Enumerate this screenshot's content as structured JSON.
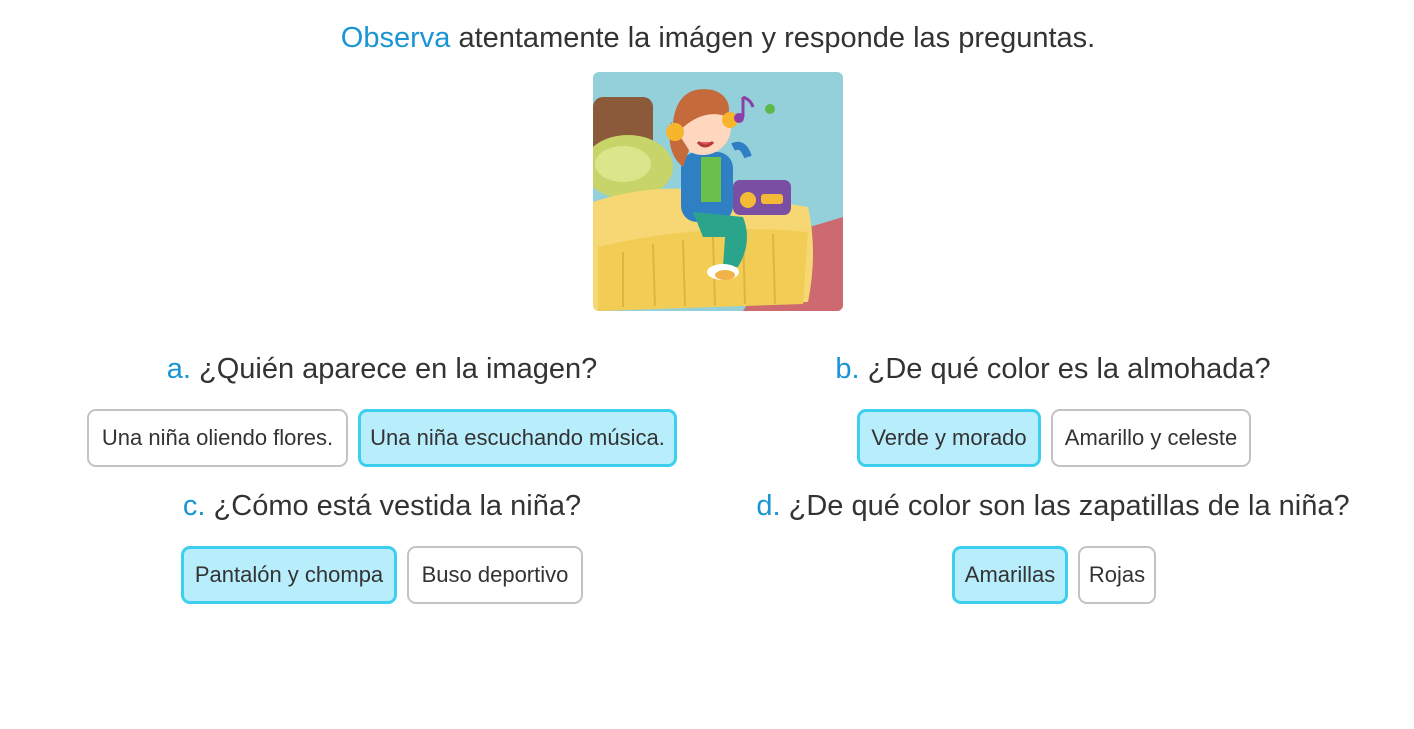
{
  "instruction": {
    "highlight": "Observa",
    "text": "atentamente la imágen y responde las preguntas."
  },
  "colors": {
    "accent": "#1a95d4",
    "selected_bg": "#b8edfb",
    "selected_border": "#3dcfee",
    "option_border": "#c3c3c3"
  },
  "illustration": {
    "subject": "girl-listening-music-on-bed"
  },
  "questions": [
    {
      "letter": "a.",
      "text": "¿Quién aparece en la imagen?",
      "options": [
        {
          "label": "Una niña oliendo flores.",
          "selected": false
        },
        {
          "label": "Una niña escuchando música.",
          "selected": true
        }
      ]
    },
    {
      "letter": "b.",
      "text": "¿De qué color es la almohada?",
      "options": [
        {
          "label": "Verde y morado",
          "selected": true
        },
        {
          "label": "Amarillo y celeste",
          "selected": false
        }
      ]
    },
    {
      "letter": "c.",
      "text": "¿Cómo está vestida la niña?",
      "options": [
        {
          "label": "Pantalón y chompa",
          "selected": true
        },
        {
          "label": "Buso deportivo",
          "selected": false
        }
      ]
    },
    {
      "letter": "d.",
      "text": "¿De qué color son las zapatillas de la niña?",
      "options": [
        {
          "label": "Amarillas",
          "selected": true
        },
        {
          "label": "Rojas",
          "selected": false
        }
      ]
    }
  ]
}
